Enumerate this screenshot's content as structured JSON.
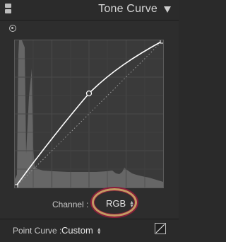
{
  "header": {
    "title": "Tone Curve",
    "collapse_icon": "panel-grip-icon",
    "toggle_icon": "triangle-down-icon"
  },
  "tools": {
    "targeted_adjustment_icon": "target-icon"
  },
  "graph": {
    "curve_color": "#ffffff",
    "histogram_color": "#6b6b6b",
    "grid_color": "#4a4a4a",
    "background_color": "#3a3a3a"
  },
  "channel": {
    "label": "Channel :",
    "value": "RGB",
    "highlight_ring_color": "#c59a62"
  },
  "point_curve": {
    "label": "Point Curve :",
    "value": "Custom",
    "edit_icon": "curve-edit-icon"
  }
}
